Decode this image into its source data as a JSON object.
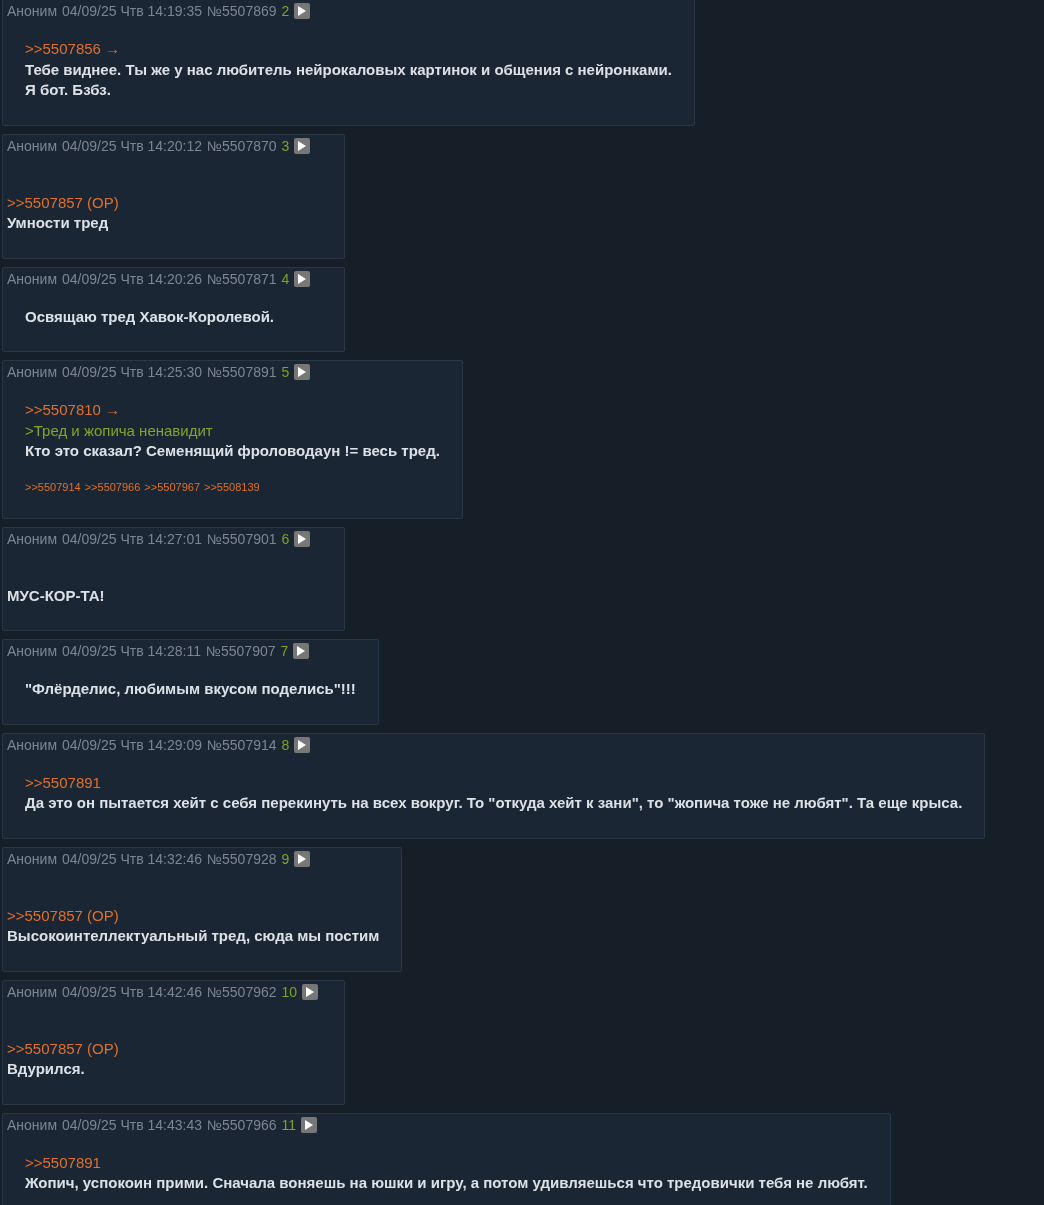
{
  "posts": [
    {
      "name": "Аноним",
      "date": "04/09/25 Чтв 14:19:35",
      "number": "№5507869",
      "index": "2",
      "kind": "indented",
      "lines": [
        {
          "kind": "reply",
          "text": ">>5507856 →"
        },
        {
          "kind": "text",
          "text": "Тебе виднее. Ты же у нас любитель нейрокаловых картинок и общения с нейронками."
        },
        {
          "kind": "text",
          "text": "Я бот. Бзбз."
        }
      ]
    },
    {
      "name": "Аноним",
      "date": "04/09/25 Чтв 14:20:12",
      "number": "№5507870",
      "index": "3",
      "kind": "plain",
      "lines": [
        {
          "kind": "reply",
          "text": ">>5507857 (OP)"
        },
        {
          "kind": "text",
          "text": "Умности тред"
        }
      ]
    },
    {
      "name": "Аноним",
      "date": "04/09/25 Чтв 14:20:26",
      "number": "№5507871",
      "index": "4",
      "kind": "indented",
      "lines": [
        {
          "kind": "text",
          "text": "Освящаю тред Хавок-Королевой."
        }
      ]
    },
    {
      "name": "Аноним",
      "date": "04/09/25 Чтв 14:25:30",
      "number": "№5507891",
      "index": "5",
      "kind": "indented",
      "lines": [
        {
          "kind": "reply",
          "text": ">>5507810 →"
        },
        {
          "kind": "quote",
          "text": ">Тред и жопича ненавидит"
        },
        {
          "kind": "text",
          "text": "Кто это сказал? Семенящий фроловодаун != весь тред."
        }
      ],
      "replies": [
        ">>5507914",
        ">>5507966",
        ">>5507967",
        ">>5508139"
      ]
    },
    {
      "name": "Аноним",
      "date": "04/09/25 Чтв 14:27:01",
      "number": "№5507901",
      "index": "6",
      "kind": "plain",
      "lines": [
        {
          "kind": "bold",
          "text": "МУС-КОР-ТА!"
        }
      ]
    },
    {
      "name": "Аноним",
      "date": "04/09/25 Чтв 14:28:11",
      "number": "№5507907",
      "index": "7",
      "kind": "indented",
      "lines": [
        {
          "kind": "text",
          "text": "\"Флёрделис, любимым вкусом поделись\"!!!"
        }
      ]
    },
    {
      "name": "Аноним",
      "date": "04/09/25 Чтв 14:29:09",
      "number": "№5507914",
      "index": "8",
      "kind": "indented",
      "lines": [
        {
          "kind": "reply",
          "text": ">>5507891"
        },
        {
          "kind": "text",
          "text": "Да это он пытается хейт с себя перекинуть на всех вокруг. То \"откуда хейт к зани\", то \"жопича тоже не любят\". Та еще крыса."
        }
      ]
    },
    {
      "name": "Аноним",
      "date": "04/09/25 Чтв 14:32:46",
      "number": "№5507928",
      "index": "9",
      "kind": "plain",
      "lines": [
        {
          "kind": "reply",
          "text": ">>5507857 (OP)"
        },
        {
          "kind": "text",
          "text": "Высокоинтеллектуальный тред, сюда мы постим"
        }
      ]
    },
    {
      "name": "Аноним",
      "date": "04/09/25 Чтв 14:42:46",
      "number": "№5507962",
      "index": "10",
      "kind": "plain",
      "lines": [
        {
          "kind": "reply",
          "text": ">>5507857 (OP)"
        },
        {
          "kind": "text",
          "text": "Вдурился."
        }
      ]
    },
    {
      "name": "Аноним",
      "date": "04/09/25 Чтв 14:43:43",
      "number": "№5507966",
      "index": "11",
      "kind": "indented",
      "lines": [
        {
          "kind": "reply",
          "text": ">>5507891"
        },
        {
          "kind": "text",
          "text": "Жопич, успокоин прими. Сначала воняешь на юшки и игру, а потом удивляешься что тредовички тебя не любят."
        }
      ]
    }
  ]
}
